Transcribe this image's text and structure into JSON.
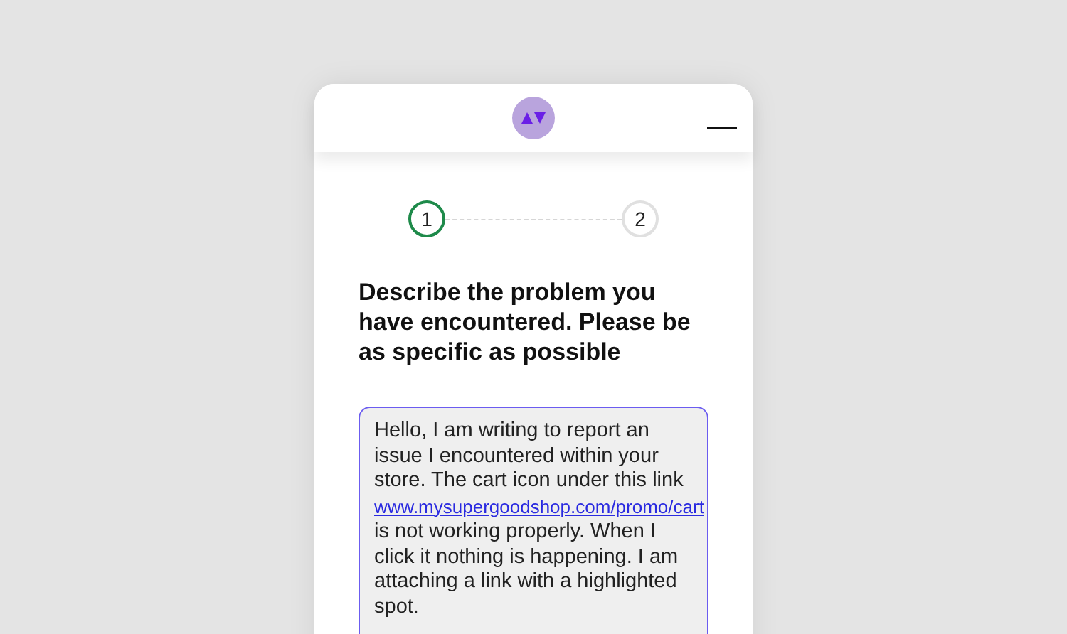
{
  "steps": [
    {
      "label": "1",
      "selected": true
    },
    {
      "label": "2",
      "selected": false
    }
  ],
  "heading": "Describe the problem you have encountered. Please be as specific as possible",
  "message": {
    "before": "Hello,  I am writing to report an issue I encountered within your store. The cart icon under this link ",
    "link": "www.mysupergoodshop.com/promo/cart",
    "after": " is not working properly.  When I click it nothing is happening. I am attaching a link with a highlighted spot."
  }
}
